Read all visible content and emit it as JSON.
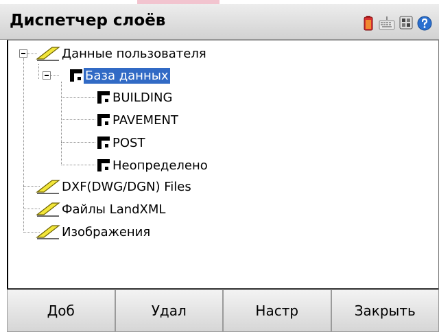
{
  "window": {
    "title": "Диспетчер слоёв"
  },
  "tree": {
    "root": {
      "label": "Данные пользователя",
      "expanded": true,
      "children": {
        "database": {
          "label": "База данных",
          "selected": true,
          "expanded": true,
          "layers": [
            "BUILDING",
            "PAVEMENT",
            "POST",
            "Неопределено"
          ]
        }
      }
    },
    "siblings": [
      "DXF(DWG/DGN) Files",
      "Файлы LandXML",
      "Изображения"
    ]
  },
  "toolbar": {
    "add_label": "Доб",
    "delete_label": "Удал",
    "settings_label": "Настр",
    "close_label": "Закрыть"
  },
  "colors": {
    "selection": "#316ac5",
    "title_bar": "#dedede",
    "accent_pink": "#f2c4cf"
  },
  "icons": {
    "battery": "battery-icon",
    "keyboard": "keyboard-icon",
    "settings": "settings-icon",
    "help": "help-icon",
    "folder": "layer-folder-icon",
    "layer": "layer-icon"
  }
}
